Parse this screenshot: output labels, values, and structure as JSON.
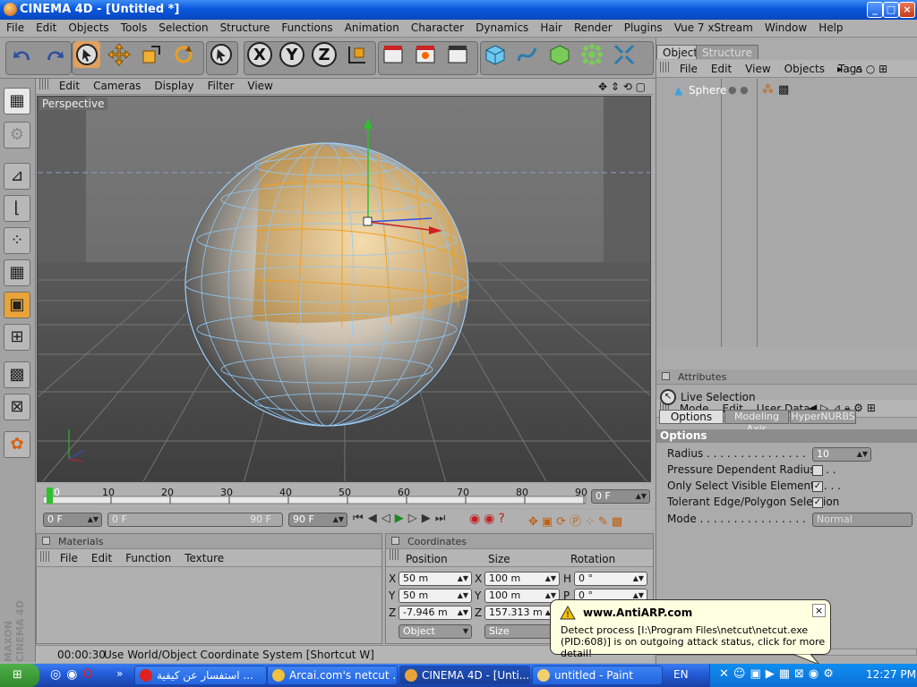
{
  "window": {
    "title": "CINEMA 4D - [Untitled *]"
  },
  "menubar": [
    "File",
    "Edit",
    "Objects",
    "Tools",
    "Selection",
    "Structure",
    "Functions",
    "Animation",
    "Character",
    "Dynamics",
    "Hair",
    "Render",
    "Plugins",
    "Vue 7 xStream",
    "Window",
    "Help"
  ],
  "viewport": {
    "menu": [
      "Edit",
      "Cameras",
      "Display",
      "Filter",
      "View"
    ],
    "label": "Perspective"
  },
  "timeline": {
    "ticks": [
      "0",
      "10",
      "20",
      "30",
      "40",
      "50",
      "60",
      "70",
      "80",
      "90"
    ],
    "current_frame": "0 F",
    "start_field": "0 F",
    "range_start": "0 F",
    "range_end": "90 F",
    "end_field": "90 F"
  },
  "materials": {
    "title": "Materials",
    "menu": [
      "File",
      "Edit",
      "Function",
      "Texture"
    ]
  },
  "coordinates": {
    "title": "Coordinates",
    "headers": [
      "Position",
      "Size",
      "Rotation"
    ],
    "rows": [
      {
        "axis": "X",
        "pos": "50 m",
        "saxis": "X",
        "size": "100 m",
        "raxis": "H",
        "rot": "0 °"
      },
      {
        "axis": "Y",
        "pos": "50 m",
        "saxis": "Y",
        "size": "100 m",
        "raxis": "P",
        "rot": "0 °"
      },
      {
        "axis": "Z",
        "pos": "-7.946 m",
        "saxis": "Z",
        "size": "157.313 m",
        "raxis": "",
        "rot": ""
      }
    ],
    "mode_select": "Object",
    "size_select": "Size"
  },
  "status": {
    "time": "00:00:30",
    "message": "Use World/Object Coordinate System [Shortcut W]"
  },
  "objects_panel": {
    "tabs": [
      "Objects",
      "Structure"
    ],
    "menu": [
      "File",
      "Edit",
      "View",
      "Objects",
      "Tags"
    ],
    "items": [
      {
        "name": "Sphere"
      }
    ]
  },
  "attributes": {
    "title": "Attributes",
    "menu": [
      "Mode",
      "Edit",
      "User Data"
    ],
    "tool": "Live Selection",
    "tabs": [
      "Options",
      "Modeling Axis",
      "HyperNURBS"
    ],
    "section": "Options",
    "radius_label": "Radius . . . . . . . . . . . . . . .",
    "radius_value": "10",
    "pressure_label": "Pressure Dependent Radius . . .",
    "visible_label": "Only Select Visible Elements . . .",
    "tolerant_label": "Tolerant Edge/Polygon Selection",
    "mode_label": "Mode . . . . . . . . . . . . . . . .",
    "mode_value": "Normal"
  },
  "balloon": {
    "title": "www.AntiARP.com",
    "text": "Detect process [I:\\Program Files\\netcut\\netcut.exe (PID:608)] is on outgoing attack status, click for more detail!"
  },
  "taskbar": {
    "tasks": [
      "استفسار عن كيفية ...",
      "Arcai.com's netcut ...",
      "CINEMA 4D - [Unti...",
      "untitled - Paint"
    ],
    "lang": "EN",
    "clock": "12:27 PM"
  },
  "branding": "MAXON CINEMA 4D",
  "colors": {
    "accent": "#0a58dc",
    "selection": "#e8a33a",
    "wire": "#9fd0ff"
  }
}
